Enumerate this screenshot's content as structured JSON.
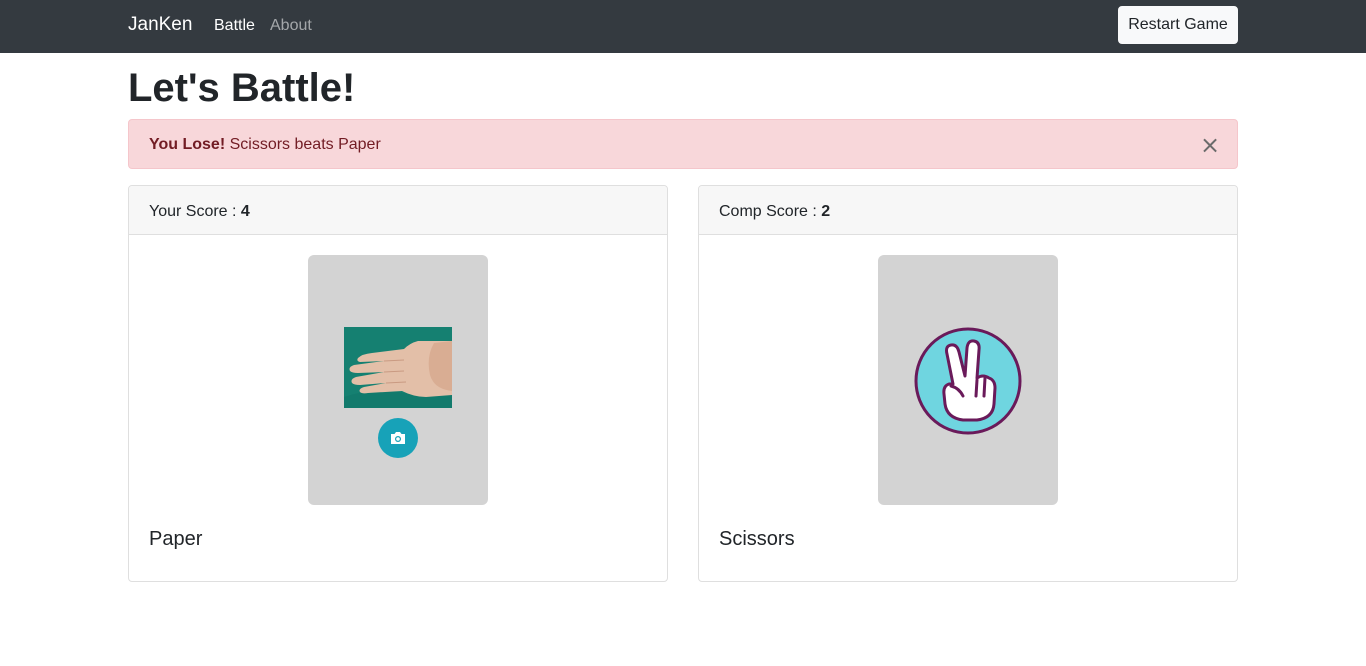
{
  "navbar": {
    "brand": "JanKen",
    "links": [
      {
        "label": "Battle",
        "active": true
      },
      {
        "label": "About",
        "active": false
      }
    ],
    "restart_label": "Restart Game"
  },
  "page": {
    "title": "Let's Battle!"
  },
  "alert": {
    "strong": "You Lose!",
    "message": " Scissors beats Paper",
    "close_symbol": "×"
  },
  "player": {
    "score_label": "Your Score : ",
    "score": "4",
    "move": "Paper",
    "camera_icon": "camera-icon"
  },
  "computer": {
    "score_label": "Comp Score : ",
    "score": "2",
    "move": "Scissors"
  },
  "colors": {
    "navbar": "#343a40",
    "alert_bg": "#f8d7da",
    "alert_text": "#721c24",
    "camera_button": "#17a2b8",
    "scissors_circle": "#6fd5e0",
    "scissors_ring": "#6a1a5a"
  }
}
